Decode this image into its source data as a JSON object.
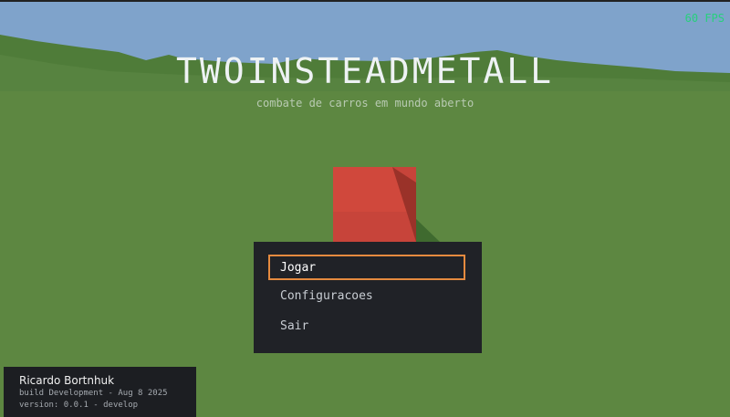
{
  "game": {
    "title": "TWOINSTEADMETALL",
    "subtitle": "combate de carros em mundo aberto",
    "fps": "60 FPS"
  },
  "menu": {
    "items": [
      {
        "label": "Jogar",
        "selected": true
      },
      {
        "label": "Configuracoes",
        "selected": false
      },
      {
        "label": "Sair",
        "selected": false
      }
    ]
  },
  "credits": {
    "author": "Ricardo Bortnhuk",
    "build": "build Development - Aug  8 2025",
    "version": "version: 0.0.1 - develop"
  },
  "colors": {
    "sky": "#7fa3cb",
    "ground": "#5d8741",
    "hills": "#4c7a36",
    "cube": "#c8453a",
    "menu_bg": "#202227",
    "selection_border": "#e58a3f",
    "fps_text": "#27d07c"
  }
}
